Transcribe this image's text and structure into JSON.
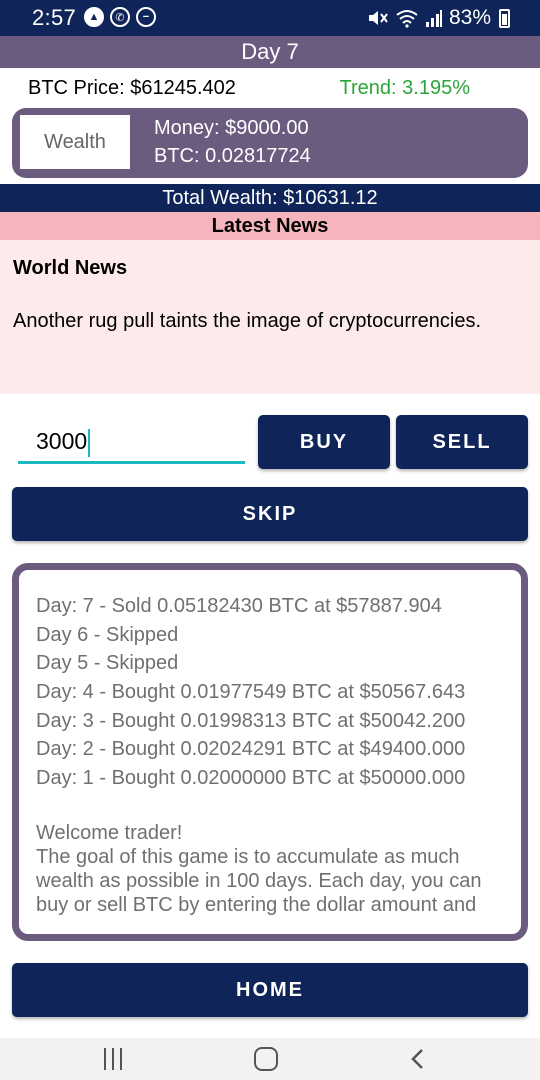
{
  "status_bar": {
    "time": "2:57",
    "notification_icons": [
      "navigation-icon",
      "whatsapp-icon",
      "do-not-disturb-icon"
    ],
    "right_icons": [
      "mute-icon",
      "wifi-icon",
      "signal-icon"
    ],
    "battery": "83%"
  },
  "header": {
    "day": "Day 7"
  },
  "market": {
    "btc_price": "BTC Price: $61245.402",
    "trend": "Trend: 3.195%"
  },
  "wealth": {
    "tab_label": "Wealth",
    "money": "Money: $9000.00",
    "btc": "BTC: 0.02817724"
  },
  "total_wealth": "Total Wealth: $10631.12",
  "news": {
    "header": "Latest News",
    "title": "World News",
    "body": "Another rug pull taints the image of cryptocurrencies."
  },
  "trade": {
    "amount_value": "3000",
    "buy_label": "BUY",
    "sell_label": "SELL",
    "skip_label": "SKIP"
  },
  "log": {
    "entries": [
      "Day: 7 - Sold 0.05182430 BTC at $57887.904",
      "Day 6 - Skipped",
      "Day 5 - Skipped",
      "Day: 4 - Bought 0.01977549 BTC at $50567.643",
      "Day: 3 - Bought 0.01998313 BTC at $50042.200",
      "Day: 2 - Bought 0.02024291 BTC at $49400.000",
      "Day: 1 - Bought 0.02000000 BTC at $50000.000"
    ],
    "welcome_title": "Welcome trader!",
    "welcome_body": "The goal of this game is to accumulate as much wealth as possible in 100 days. Each day, you can buy or sell BTC by entering the dollar amount and"
  },
  "home_label": "HOME",
  "nav": [
    "recent-apps-icon",
    "home-icon",
    "back-icon"
  ],
  "colors": {
    "navy": "#0f2458",
    "purple": "#6b5b7f",
    "trend_green": "#2aa53a",
    "news_pink": "#f6b5bc",
    "input_teal": "#1ab8c0"
  }
}
